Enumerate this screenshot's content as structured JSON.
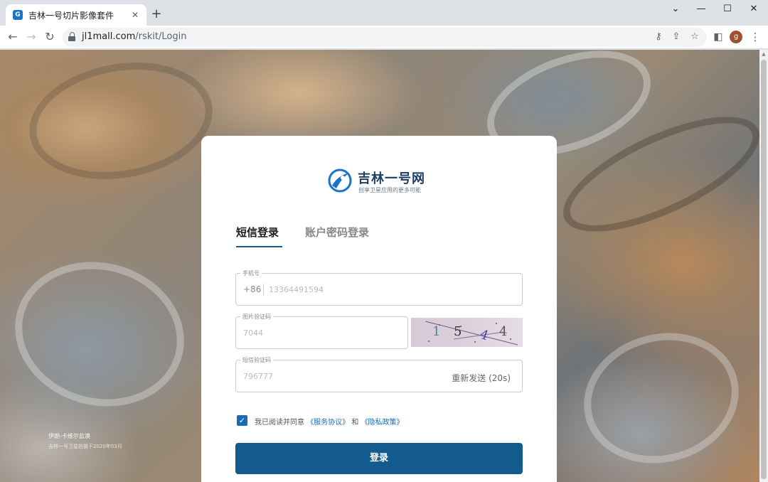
{
  "browser": {
    "tab_title": "吉林一号切片影像套件",
    "url_host": "jl1mall.com",
    "url_path": "/rskit/Login",
    "avatar_letter": "g"
  },
  "page": {
    "caption_title": "伊朗-卡维尔盐漠",
    "caption_sub": "吉林一号卫星拍摄于2020年03月"
  },
  "login": {
    "brand_name": "吉林一号网",
    "slogan": "创享卫星应用的更多可能",
    "tabs": [
      "短信登录",
      "账户密码登录"
    ],
    "phone": {
      "label": "手机号",
      "prefix": "+86",
      "value": "13364491594"
    },
    "image_code": {
      "label": "图片验证码",
      "value": "7044"
    },
    "captcha_chars": [
      "1",
      "5",
      "4",
      "4"
    ],
    "sms_code": {
      "label": "短信验证码",
      "value": "796777",
      "resend": "重新发送 (20s)"
    },
    "agree_prefix": "我已阅读并同意",
    "agree_link1": "《服务协议》",
    "agree_and": "和",
    "agree_link2": "《隐私政策》",
    "submit": "登录"
  },
  "colors": {
    "primary": "#135b8d",
    "checkbox": "#1a6bb5",
    "brand_text": "#1d3d63"
  }
}
